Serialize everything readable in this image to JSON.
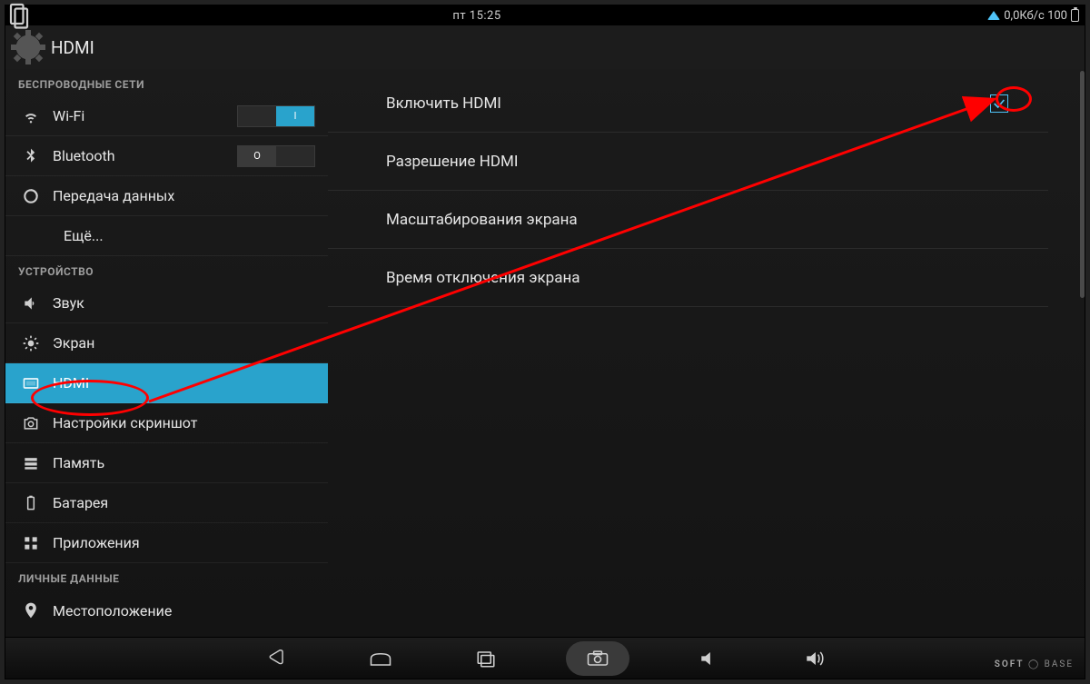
{
  "statusbar": {
    "time": "пт 15:25",
    "right": "0,0Кб/с 100"
  },
  "header": {
    "title": "HDMI"
  },
  "sidebar": {
    "sections": [
      {
        "header": "БЕСПРОВОДНЫЕ СЕТИ"
      },
      {
        "header": "УСТРОЙСТВО"
      },
      {
        "header": "ЛИЧНЫЕ ДАННЫЕ"
      }
    ],
    "wifi": {
      "label": "Wi-Fi",
      "toggle_on": "I"
    },
    "bluetooth": {
      "label": "Bluetooth",
      "toggle_off": "O"
    },
    "data": {
      "label": "Передача данных"
    },
    "more": {
      "label": "Ещё..."
    },
    "sound": {
      "label": "Звук"
    },
    "display": {
      "label": "Экран"
    },
    "hdmi": {
      "label": "HDMI"
    },
    "screenshot": {
      "label": "Настройки скриншот"
    },
    "storage": {
      "label": "Память"
    },
    "battery": {
      "label": "Батарея"
    },
    "apps": {
      "label": "Приложения"
    },
    "location": {
      "label": "Местоположение"
    }
  },
  "main": {
    "enable": {
      "label": "Включить HDMI",
      "checked": true
    },
    "resolution": {
      "label": "Разрешение HDMI"
    },
    "scale": {
      "label": "Масштабирования экрана"
    },
    "timeout": {
      "label": "Время отключения экрана"
    }
  },
  "brand": {
    "t1": "SOFT",
    "t2": "BASE"
  }
}
